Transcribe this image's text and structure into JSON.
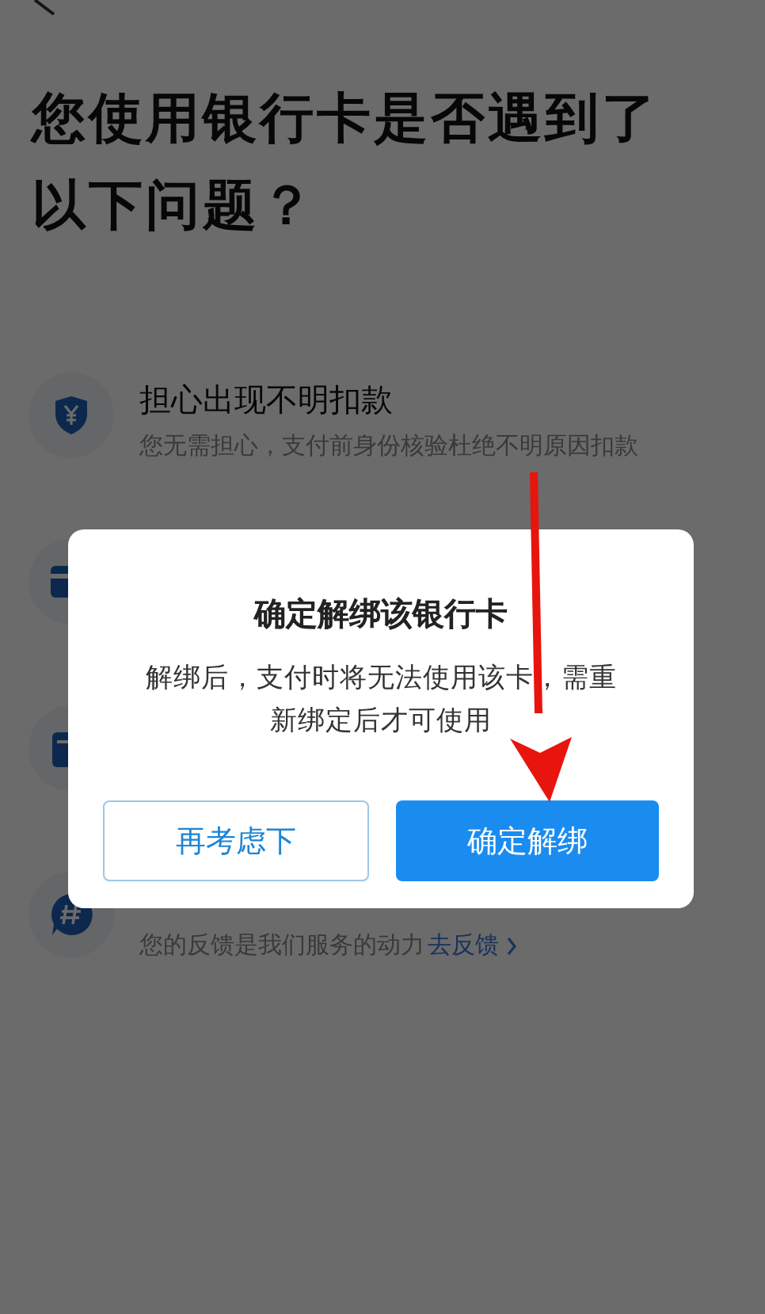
{
  "heading": "您使用银行卡是否遇到了以下问题？",
  "issues": [
    {
      "kind": "shield",
      "title": "担心出现不明扣款",
      "subtitle": "您无需担心，支付前身份核验杜绝不明原因扣款"
    },
    {
      "kind": "card"
    },
    {
      "kind": "calendar"
    },
    {
      "kind": "chat",
      "subtitle": "您的反馈是我们服务的动力",
      "link": "去反馈"
    }
  ],
  "dialog": {
    "title": "确定解绑该银行卡",
    "message": "解绑后，支付时将无法使用该卡，需重新绑定后才可使用",
    "buttons": [
      {
        "label": "再考虑下",
        "kind": "secondary"
      },
      {
        "label": "确定解绑",
        "kind": "primary"
      }
    ]
  },
  "annotation": {
    "kind": "arrow"
  }
}
